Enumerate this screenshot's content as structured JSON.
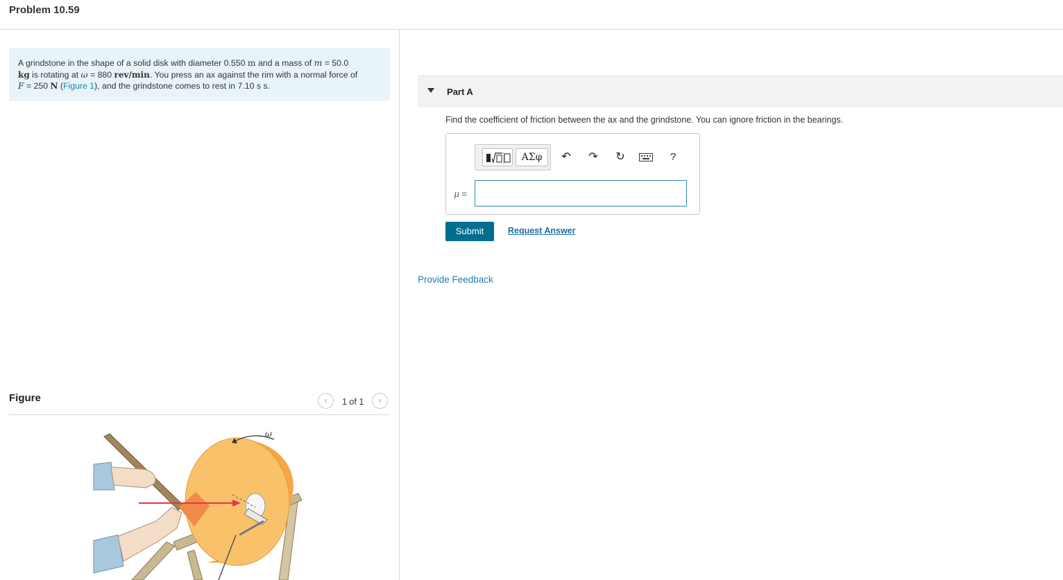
{
  "header": {
    "title": "Problem 10.59"
  },
  "problem": {
    "p1": "A grindstone in the shape of a solid disk with diameter 0.550 ",
    "u_m": "m",
    "p2": " and a mass of ",
    "var_m": "m",
    "p3": " = 50.0",
    "u_kg": "kg",
    "p4": " is rotating at ",
    "var_omega": "ω",
    "p5": " = 880 ",
    "u_revmin": "rev/min",
    "p6": ". You press an ax against the rim with a normal force of",
    "var_F": "F",
    "p7": " = 250 ",
    "u_N": "N",
    "p8": " (",
    "figure_link": "Figure 1",
    "p9": "), and the grindstone comes to rest in 7.10 s s."
  },
  "figure": {
    "label": "Figure",
    "pager_text": "1 of 1",
    "prev_icon": "chevron-left-icon",
    "next_icon": "chevron-right-icon",
    "omega_label": "ω",
    "colors": {
      "disk": "#f9c26a",
      "disk_side": "#f4a745",
      "arrow": "#e8334a",
      "wood": "#c9b993",
      "skin": "#f3dcc8",
      "sleeve": "#a8c8de"
    }
  },
  "partA": {
    "title": "Part A",
    "question": "Find the coefficient of friction between the ax and the grindstone. You can ignore friction in the bearings.",
    "toolbar": {
      "templates_icon": "math-templates-icon",
      "greek_label": "ΑΣφ",
      "undo_icon": "undo-icon",
      "redo_icon": "redo-icon",
      "reset_icon": "reset-icon",
      "keyboard_icon": "keyboard-icon",
      "help_label": "?"
    },
    "answer": {
      "var": "μ",
      "eq": " =",
      "value": ""
    },
    "submit_label": "Submit",
    "request_label": "Request Answer"
  },
  "feedback_label": "Provide Feedback"
}
